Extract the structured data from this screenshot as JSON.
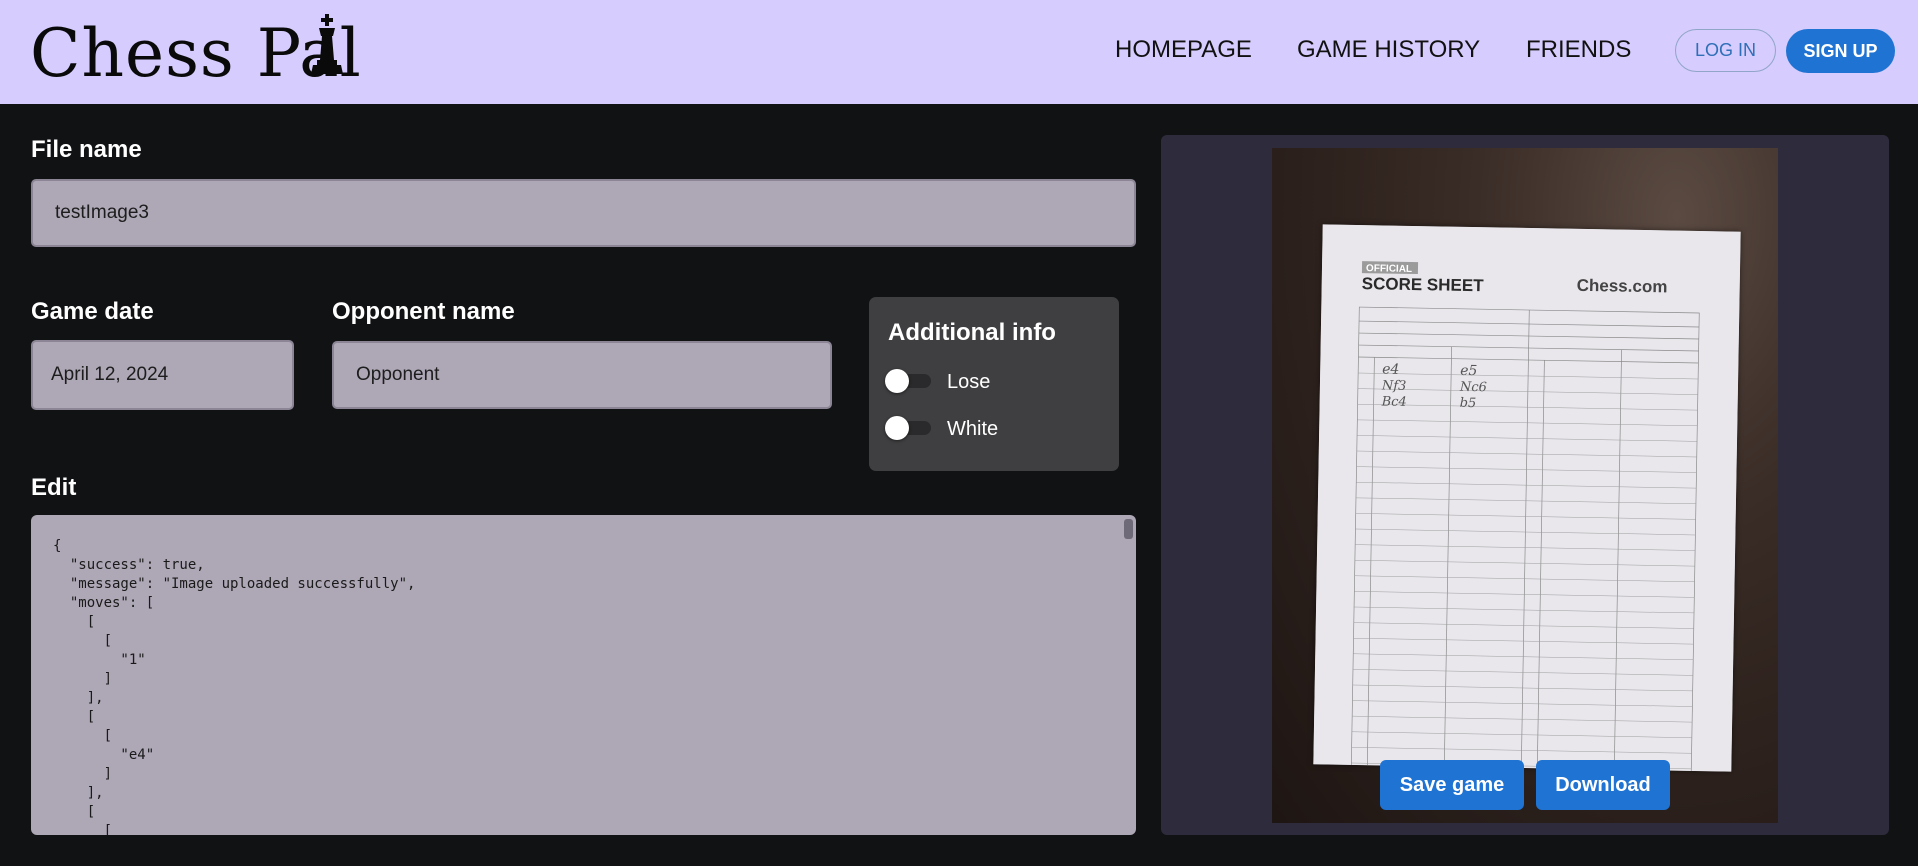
{
  "header": {
    "logo_text": "Chess Pal",
    "nav": {
      "homepage": "HOMEPAGE",
      "game_history": "GAME HISTORY",
      "friends": "FRIENDS"
    },
    "login_label": "LOG IN",
    "signup_label": "SIGN UP"
  },
  "form": {
    "file_name_label": "File name",
    "file_name_value": "testImage3",
    "game_date_label": "Game date",
    "game_date_value": "April 12, 2024",
    "opponent_label": "Opponent name",
    "opponent_value": "Opponent",
    "additional_info_title": "Additional info",
    "toggles": [
      {
        "label": "Lose",
        "on": false
      },
      {
        "label": "White",
        "on": false
      }
    ],
    "edit_label": "Edit",
    "edit_value": "{\n  \"success\": true,\n  \"message\": \"Image uploaded successfully\",\n  \"moves\": [\n    [\n      [\n        \"1\"\n      ]\n    ],\n    [\n      [\n        \"e4\"\n      ]\n    ],\n    [\n      ["
  },
  "preview": {
    "sheet": {
      "official": "OFFICIAL",
      "title": "SCORE SHEET",
      "brand": "Chess.com",
      "moves_white": [
        "e4",
        "Nf3",
        "Bc4"
      ],
      "moves_black": [
        "e5",
        "Nc6",
        "b5"
      ]
    },
    "save_label": "Save game",
    "download_label": "Download"
  },
  "colors": {
    "header_bg": "#d6ccfd",
    "page_bg": "#111214",
    "field_bg": "#aea7b6",
    "accent": "#1f73d3",
    "panel_bg": "#2e2b3d"
  }
}
